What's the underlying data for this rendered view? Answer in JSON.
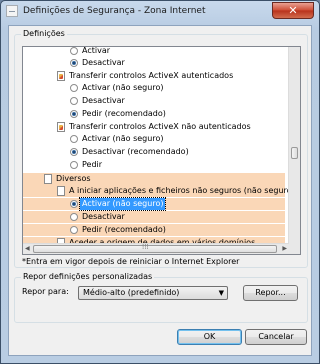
{
  "window": {
    "title": "Definições de Segurança - Zona Internet",
    "close_label": "✕"
  },
  "settings_group": {
    "label": "Definições",
    "items": [
      {
        "kind": "radio",
        "label": "Activar",
        "checked": false
      },
      {
        "kind": "radio",
        "label": "Desactivar",
        "checked": true
      },
      {
        "kind": "header",
        "label": "Transferir controlos ActiveX autenticados",
        "icon": "shield-icon"
      },
      {
        "kind": "radio",
        "label": "Activar (não seguro)",
        "checked": false
      },
      {
        "kind": "radio",
        "label": "Desactivar",
        "checked": false
      },
      {
        "kind": "radio",
        "label": "Pedir (recomendado)",
        "checked": true
      },
      {
        "kind": "header",
        "label": "Transferir controlos ActiveX não autenticados",
        "icon": "shield-icon"
      },
      {
        "kind": "radio",
        "label": "Activar (não seguro)",
        "checked": false
      },
      {
        "kind": "radio",
        "label": "Desactivar (recomendado)",
        "checked": true
      },
      {
        "kind": "radio",
        "label": "Pedir",
        "checked": false
      },
      {
        "kind": "category",
        "label": "Diversos",
        "icon": "page-icon"
      },
      {
        "kind": "header",
        "label": "A iniciar aplicações e ficheiros não seguros (não seguro)",
        "icon": "page-icon"
      },
      {
        "kind": "radio",
        "label": "Activar (não seguro)",
        "checked": true,
        "selected": true
      },
      {
        "kind": "radio",
        "label": "Desactivar",
        "checked": false
      },
      {
        "kind": "radio",
        "label": "Pedir (recomendado)",
        "checked": false
      },
      {
        "kind": "header",
        "label": "Aceder a origem de dados em vários domínios",
        "icon": "page-icon"
      }
    ]
  },
  "note": "*Entra em vigor depois de reiniciar o Internet Explorer",
  "reset_group": {
    "label": "Repor definições personalizadas",
    "reset_to_label": "Repor para:",
    "select_value": "Médio-alto (predefinido)",
    "reset_button": "Repor..."
  },
  "buttons": {
    "ok": "OK",
    "cancel": "Cancelar"
  },
  "colors": {
    "highlight": "#fad7b7",
    "selection": "#3399ff"
  }
}
